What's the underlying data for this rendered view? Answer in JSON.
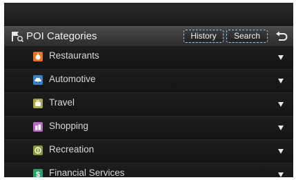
{
  "header": {
    "title": "POI Categories",
    "history_label": "History",
    "search_label": "Search"
  },
  "categories": [
    {
      "label": "Restaurants",
      "color": "#e8742a",
      "icon": "restaurant-icon"
    },
    {
      "label": "Automotive",
      "color": "#3b82c4",
      "icon": "car-icon"
    },
    {
      "label": "Travel",
      "color": "#a8a84a",
      "icon": "suitcase-icon"
    },
    {
      "label": "Shopping",
      "color": "#b46ac0",
      "icon": "shopping-bag-icon"
    },
    {
      "label": "Recreation",
      "color": "#8a9a3a",
      "icon": "recreation-icon"
    },
    {
      "label": "Financial Services",
      "color": "#2ea06a",
      "icon": "dollar-icon"
    }
  ]
}
